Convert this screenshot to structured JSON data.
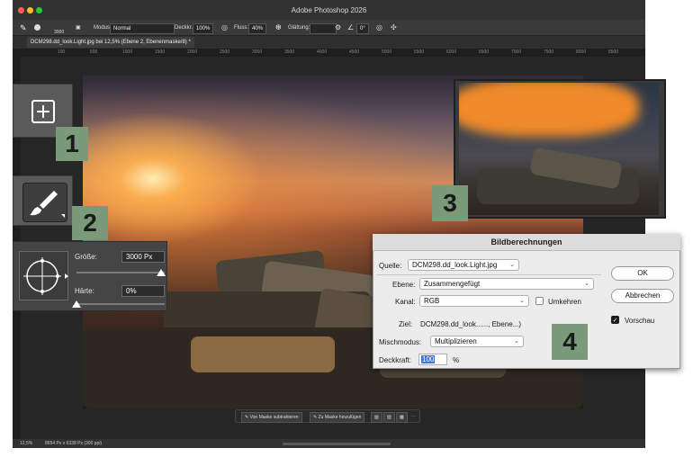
{
  "window": {
    "title": "Adobe Photoshop 2026"
  },
  "options_bar": {
    "brush_size": "3000",
    "mode_label": "Modus:",
    "mode_value": "Normal",
    "opacity_label": "Deckkr.:",
    "opacity_value": "100%",
    "flow_label": "Fluss:",
    "flow_value": "40%",
    "smoothing_label": "Glättung:",
    "angle_value": "0°"
  },
  "document_tab": {
    "label": "DCM298.dd_look.Light.jpg bei 12,5% (Ebene 2, Ebenenmaske/8) *"
  },
  "ruler": {
    "ticks": [
      "100",
      "500",
      "1000",
      "1500",
      "2000",
      "2500",
      "3000",
      "3500",
      "4000",
      "4500",
      "5000",
      "5500",
      "6000",
      "6500",
      "7000",
      "7500",
      "8000",
      "8500"
    ]
  },
  "status_bar": {
    "zoom": "12,5%",
    "dimensions": "8654 Px x 6338 Px (300 ppi)"
  },
  "callouts": {
    "one": "1",
    "two": "2",
    "three": "3",
    "four": "4"
  },
  "brush_panel": {
    "size_label": "Größe:",
    "size_value": "3000 Px",
    "hardness_label": "Härte:",
    "hardness_value": "0%",
    "size_slider_level": 1.0,
    "hardness_slider_level": 0.0
  },
  "dialog": {
    "title": "Bildberechnungen",
    "source_label": "Quelle:",
    "source_value": "DCM298.dd_look.Light.jpg",
    "layer_label": "Ebene:",
    "layer_value": "Zusammengefügt",
    "channel_label": "Kanal:",
    "channel_value": "RGB",
    "invert_label": "Umkehren",
    "invert_checked": false,
    "target_label": "Ziel:",
    "target_value": "DCM298.dd_look......, Ebene...)",
    "blend_label": "Mischmodus:",
    "blend_value": "Multiplizieren",
    "opacity_label": "Deckkraft:",
    "opacity_value": "100",
    "opacity_unit": "%",
    "ok_label": "OK",
    "cancel_label": "Abbrechen",
    "preview_label": "Vorschau",
    "preview_checked": true
  },
  "taskbar": {
    "subtract_label": "Von Maske subtrahieren",
    "add_label": "Zu Maske hinzufügen"
  },
  "colors": {
    "callout_badge": "#7a9a7a",
    "app_background": "#2b2b2b",
    "dialog_background": "#ececec",
    "mask_orange": "#f08a2a"
  }
}
